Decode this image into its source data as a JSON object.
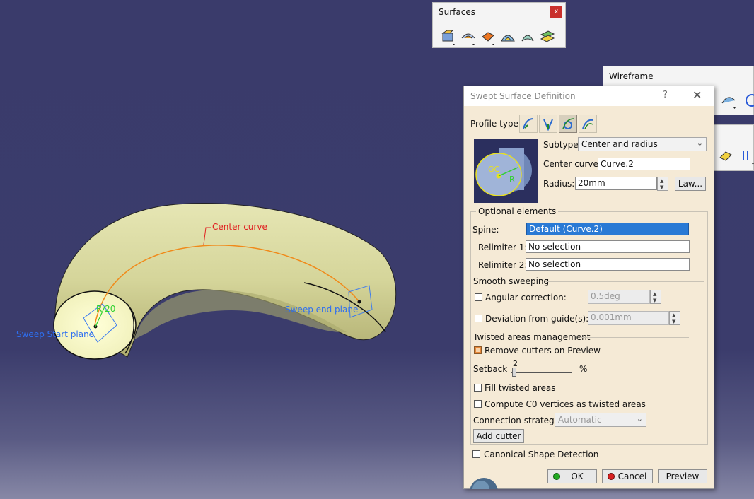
{
  "viewport": {
    "annotations": {
      "center_curve": "Center curve",
      "radius_label": "R 20",
      "start_plane": "Sweep Start plane",
      "end_plane": "Sweep end plane"
    }
  },
  "toolbars": {
    "surfaces": {
      "title": "Surfaces",
      "close": "x"
    },
    "wireframe": {
      "title": "Wireframe"
    }
  },
  "dialog": {
    "title": "Swept Surface Definition",
    "help": "?",
    "close": "✕",
    "profile_type_label": "Profile type:",
    "subtype_label": "Subtype:",
    "subtype_value": "Center and radius",
    "center_curve_label": "Center curve:",
    "center_curve_value": "Curve.2",
    "radius_label": "Radius:",
    "radius_value": "20mm",
    "law_button": "Law...",
    "preview_gc": "GC",
    "preview_r": "R",
    "optional_elements_label": "Optional elements",
    "spine_label": "Spine:",
    "spine_value": "Default (Curve.2)",
    "relimiter1_label": "Relimiter 1:",
    "relimiter1_value": "No selection",
    "relimiter2_label": "Relimiter 2:",
    "relimiter2_value": "No selection",
    "smooth_sweeping_label": "Smooth sweeping",
    "angular_correction_label": "Angular correction:",
    "angular_correction_value": "0.5deg",
    "deviation_label": "Deviation from guide(s):",
    "deviation_value": "0.001mm",
    "twisted_label": "Twisted areas management",
    "remove_cutters_label": "Remove cutters on Preview",
    "setback_label": "Setback",
    "setback_value": "2",
    "setback_unit": "%",
    "fill_twisted_label": "Fill twisted areas",
    "compute_c0_label": "Compute C0 vertices as twisted areas",
    "connection_strategy_label": "Connection strategy:",
    "connection_strategy_value": "Automatic",
    "add_cutter_button": "Add cutter",
    "canonical_label": "Canonical Shape Detection",
    "ok_button": "OK",
    "cancel_button": "Cancel",
    "preview_button": "Preview"
  },
  "colors": {
    "viewport_bg": "#3a3b6b",
    "surface_fill": "#d8d89a",
    "curve_orange": "#f08a1a",
    "annotation_red": "#e02020",
    "annotation_blue": "#2e6ff0",
    "dialog_bg": "#f5ead6",
    "selection_blue": "#2a7ad5"
  }
}
